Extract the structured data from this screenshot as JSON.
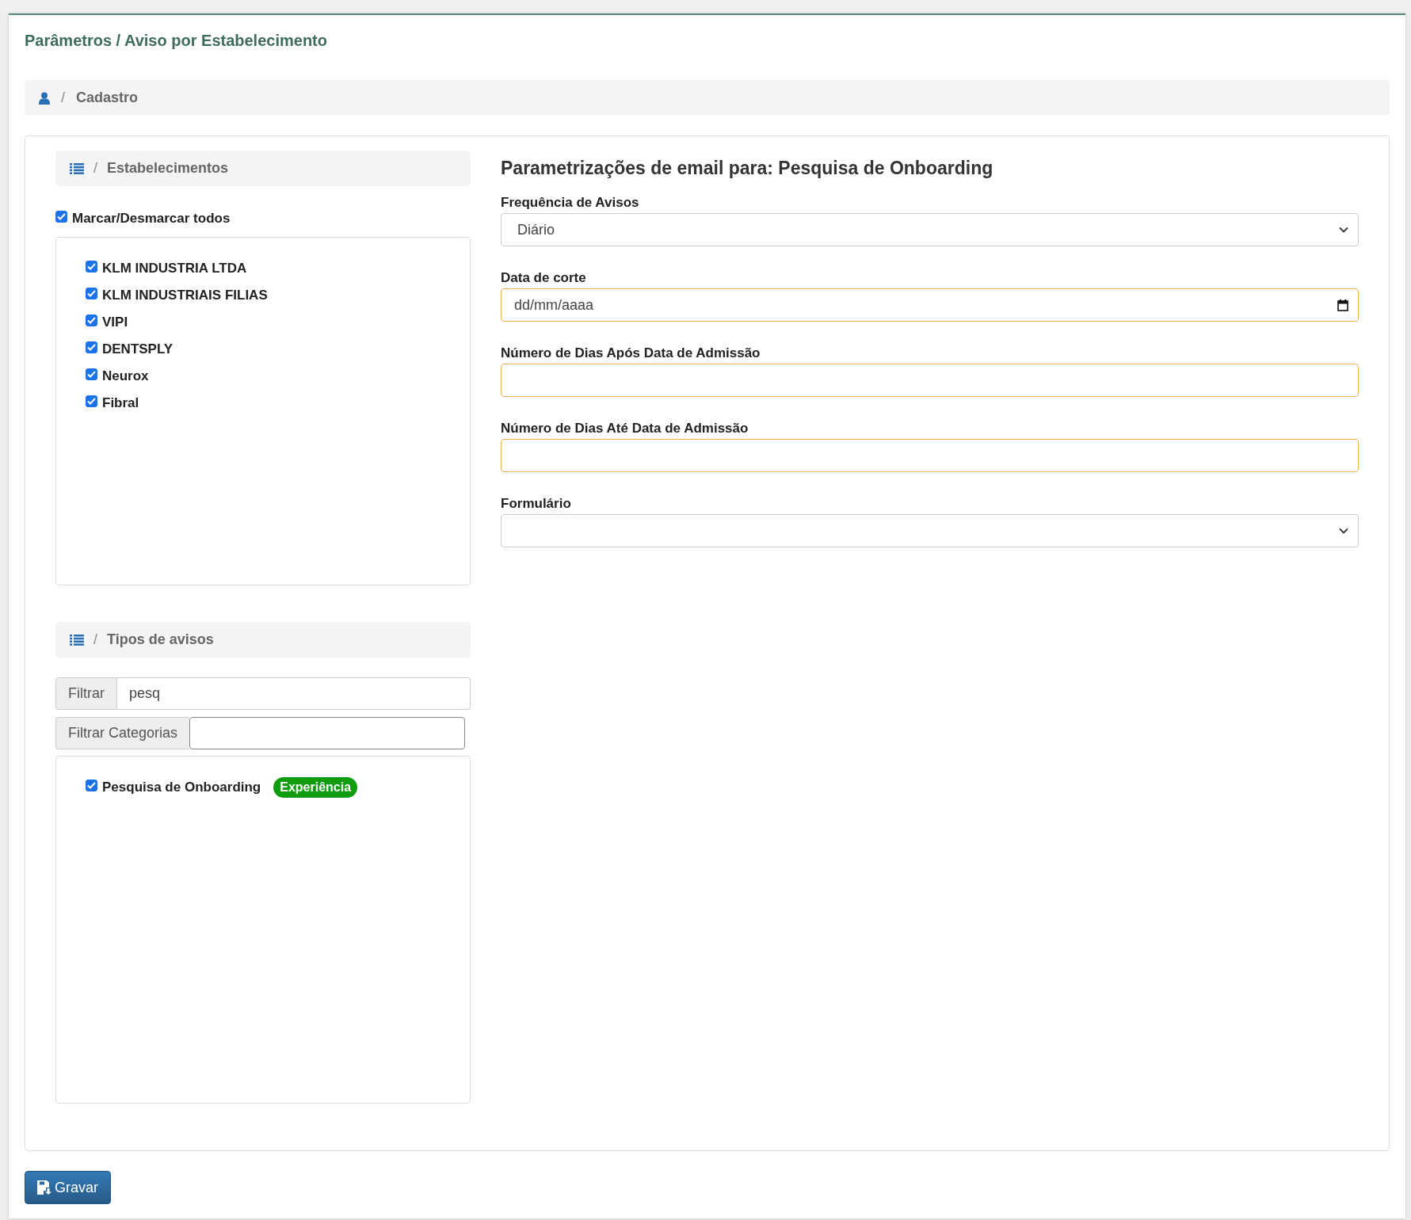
{
  "page_title": "Parâmetros / Aviso por Estabelecimento",
  "breadcrumb": {
    "separator": "/",
    "label": "Cadastro"
  },
  "establishments": {
    "header": {
      "separator": "/",
      "label": "Estabelecimentos"
    },
    "select_all": {
      "label": "Marcar/Desmarcar todos",
      "checked": true
    },
    "items": [
      {
        "label": "KLM INDUSTRIA LTDA",
        "checked": true
      },
      {
        "label": "KLM INDUSTRIAIS FILIAS",
        "checked": true
      },
      {
        "label": "VIPI",
        "checked": true
      },
      {
        "label": "DENTSPLY",
        "checked": true
      },
      {
        "label": "Neurox",
        "checked": true
      },
      {
        "label": "Fibral",
        "checked": true
      }
    ]
  },
  "notice_types": {
    "header": {
      "separator": "/",
      "label": "Tipos de avisos"
    },
    "filter": {
      "label": "Filtrar",
      "value": "pesq"
    },
    "category_filter": {
      "label": "Filtrar Categorias"
    },
    "items": [
      {
        "label": "Pesquisa de Onboarding",
        "checked": true,
        "tag": {
          "label": "Experiência",
          "color": "#0f9d0f"
        }
      }
    ]
  },
  "settings": {
    "heading": "Parametrizações de email para: Pesquisa de Onboarding",
    "fields": [
      {
        "kind": "select",
        "label": "Frequência de Avisos",
        "value": "Diário",
        "highlighted": false
      },
      {
        "kind": "date",
        "label": "Data de corte",
        "placeholder": "dd/mm/aaaa",
        "highlighted": true
      },
      {
        "kind": "text",
        "label": "Número de Dias Após Data de Admissão",
        "highlighted": true
      },
      {
        "kind": "text",
        "label": "Número de Dias Até Data de Admissão",
        "highlighted": true
      },
      {
        "kind": "select",
        "label": "Formulário",
        "highlighted": false
      }
    ]
  },
  "save_button": {
    "label": "Gravar"
  }
}
